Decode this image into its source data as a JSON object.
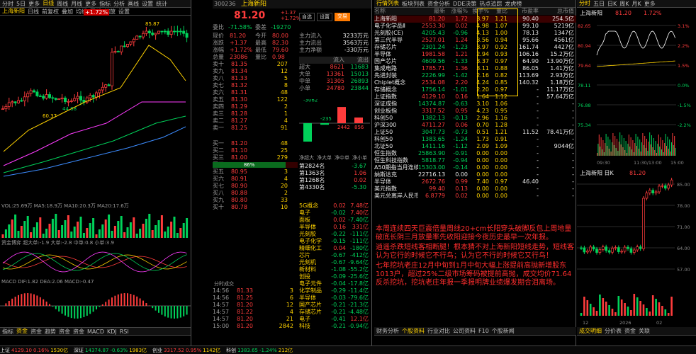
{
  "p1": {
    "topTabs": [
      "分时",
      "5日",
      "更多",
      "日线",
      "周线",
      "月线",
      "更多",
      "指标",
      "分析",
      "画线",
      "设置",
      "统计"
    ],
    "subTabs": [
      "上海新阳",
      "日线",
      "前复权",
      "叠加",
      "均线",
      "画线",
      "缩放",
      "设置"
    ],
    "badge": "+1.72%",
    "priceHi": "85.87",
    "labels": [
      "60.37",
      "44.88"
    ],
    "volTitle": "VOL:25.69万 MA5:18.9万 MA10:20.3万 MA20:17.6万",
    "macdTitle": "MACD DIF:1.82 DEA:2.06 MACD:-0.47",
    "fundTitle": "资金博弈 超大单:-1.9 大单:-2.8 中单:0.8 小单:3.9",
    "ddxTitle": "DDX:-0.12 DDY:0.08 DDZ:-3.42",
    "bottomTabs": [
      "指标",
      "资金",
      "资金",
      "趋势",
      "资金",
      "资金",
      "MACD",
      "KDJ",
      "RSI"
    ],
    "volLabel": "持续放量"
  },
  "p2": {
    "code": "300236",
    "name": "上海新阳",
    "price": "81.20",
    "chg": "+1.37",
    "pct": "+1.72%",
    "btn1": "自选",
    "btn2": "设置",
    "btn3": "交易",
    "hdr": [
      "委比",
      "-71.58%",
      "委差",
      "-19270"
    ],
    "stats": [
      [
        "现价",
        "81.20",
        "今开",
        "80.00"
      ],
      [
        "涨跌",
        "+1.37",
        "最高",
        "82.30"
      ],
      [
        "涨幅",
        "+1.72%",
        "最低",
        "79.60"
      ],
      [
        "总量",
        "23086",
        "量比",
        "0.98"
      ]
    ],
    "sells": [
      [
        "卖十",
        "81.35",
        "207"
      ],
      [
        "卖九",
        "81.34",
        "12"
      ],
      [
        "卖八",
        "81.33",
        "5"
      ],
      [
        "卖七",
        "81.32",
        "8"
      ],
      [
        "卖六",
        "81.31",
        "48"
      ],
      [
        "卖五",
        "81.30",
        "122"
      ],
      [
        "卖四",
        "81.29",
        "2"
      ],
      [
        "卖三",
        "81.28",
        "1"
      ],
      [
        "卖二",
        "81.27",
        "4"
      ],
      [
        "卖一",
        "81.25",
        "91"
      ]
    ],
    "buys": [
      [
        "买一",
        "81.20",
        "48"
      ],
      [
        "买二",
        "81.10",
        "25"
      ],
      [
        "买三",
        "81.00",
        "279"
      ],
      [
        "买四",
        "80.98",
        "1"
      ],
      [
        "买五",
        "80.95",
        "3"
      ],
      [
        "买六",
        "80.91",
        "4"
      ],
      [
        "买七",
        "80.90",
        "20"
      ],
      [
        "买八",
        "80.88",
        "2"
      ],
      [
        "买九",
        "80.80",
        "33"
      ],
      [
        "买十",
        "80.78",
        "10"
      ]
    ],
    "flowHead": [
      "流入",
      "流出"
    ],
    "flow": [
      [
        "超大",
        "8621",
        "11683"
      ],
      [
        "大单",
        "13361",
        "15013"
      ],
      [
        "中单",
        "31305",
        "26893"
      ],
      [
        "小单",
        "24780",
        "23844"
      ]
    ],
    "amt": [
      [
        "主力流入",
        "3233万元"
      ],
      [
        "主力流出",
        "3563万元"
      ],
      [
        "主力净额",
        "-330万元"
      ]
    ],
    "bars": [
      "-3062",
      "-235",
      "2442",
      "856"
    ],
    "barTabs": [
      "净超大",
      "净大单",
      "净中单",
      "净小单"
    ],
    "ranks": [
      [
        "第2824名",
        "-3.67"
      ],
      [
        "第1363名",
        "1.06"
      ],
      [
        "第1268名",
        "0.02"
      ],
      [
        "第4330名",
        "-5.30"
      ]
    ],
    "ratio": "86%",
    "ticks": [
      [
        "14:56",
        "81.33",
        "3"
      ],
      [
        "14:56",
        "81.25",
        "6"
      ],
      [
        "14:57",
        "81.20",
        "12"
      ],
      [
        "14:57",
        "81.22",
        "4"
      ],
      [
        "14:57",
        "81.20",
        "21"
      ],
      [
        "15:00",
        "81.20",
        "2842"
      ]
    ],
    "sectors": [
      [
        "5G概念",
        "0.02",
        "7.48亿"
      ],
      [
        "电子",
        "-0.02",
        "7.40亿"
      ],
      [
        "面板",
        "0.02",
        "-7.40亿"
      ],
      [
        "半导体",
        "0.16",
        "331亿"
      ],
      [
        "光刻胶",
        "-0.22",
        "-111亿"
      ],
      [
        "电子化学",
        "-0.15",
        "-111亿"
      ],
      [
        "精细化工",
        "0.04",
        "-180亿"
      ],
      [
        "芯片",
        "-0.67",
        "-412亿"
      ],
      [
        "光刻机",
        "-0.67",
        "-9.64亿"
      ],
      [
        "新材料",
        "-1.08",
        "-55.2亿"
      ],
      [
        "创投",
        "-0.09",
        "-25.6亿"
      ],
      [
        "电子元件",
        "-0.04",
        "-17.8亿"
      ],
      [
        "化学制品",
        "-0.29",
        "-11.4亿"
      ],
      [
        "半导体",
        "-0.03",
        "-79.6亿"
      ],
      [
        "国产芯片",
        "-0.21",
        "-21.3亿"
      ],
      [
        "存储芯片",
        "-0.21",
        "-4.48亿"
      ],
      [
        "电子",
        "-0.41",
        "12.1亿"
      ],
      [
        "科技",
        "-0.21",
        "-0.94亿"
      ]
    ],
    "status": "分时成交"
  },
  "p3": {
    "tabs": [
      "行情列表",
      "板块列表",
      "资金分析",
      "DDE决策",
      "热点追踪",
      "龙虎榜"
    ],
    "head": [
      "名称",
      "最新",
      "涨幅%",
      "换手%",
      "量比",
      "市盈率",
      "总市值"
    ],
    "rows": [
      [
        "上海新阳",
        "81.20",
        "1.72",
        "3.97",
        "1.21",
        "90.40",
        "254.5亿"
      ],
      [
        "电子化学品Ⅱ",
        "2553.30",
        "0.02",
        "4.98",
        "1.07",
        "99.10",
        "5219亿"
      ],
      [
        "光刻胶(CE)",
        "4205.43",
        "-0.96",
        "4.13",
        "1.00",
        "78.13",
        "1347亿"
      ],
      [
        "第三代半导",
        "2527.01",
        "1.24",
        "3.56",
        "0.94",
        "95.66",
        "4561亿"
      ],
      [
        "存储芯片",
        "2301.24",
        "-1.23",
        "3.97",
        "0.92",
        "161.74",
        "4427亿"
      ],
      [
        "半导体",
        "1981.58",
        "1.21",
        "2.94",
        "0.93",
        "106.16",
        "15.2万亿"
      ],
      [
        "国产芯片",
        "4609.56",
        "-1.33",
        "3.37",
        "0.97",
        "64.90",
        "13.90万亿"
      ],
      [
        "集成电路",
        "1785.71",
        "1.36",
        "3.11",
        "0.88",
        "86.05",
        "1.41万亿"
      ],
      [
        "先进封装",
        "2226.99",
        "-1.42",
        "2.16",
        "0.82",
        "113.69",
        "2.93万亿"
      ],
      [
        "Chiplet概念",
        "2534.08",
        "2.20",
        "4.24",
        "0.85",
        "140.32",
        "1.18万亿"
      ],
      [
        "存储概念",
        "1756.14",
        "-1.01",
        "2.20",
        "0.97",
        "-",
        "11.17万亿"
      ],
      [
        "上证指数",
        "4129.10",
        "0.16",
        "1.64",
        "1.12",
        "-",
        "57.64万亿"
      ],
      [
        "深证成指",
        "14374.87",
        "-0.63",
        "3.10",
        "1.06",
        "-",
        "-"
      ],
      [
        "创业板指",
        "3317.52",
        "0.95",
        "4.23",
        "0.95",
        "-",
        "-"
      ],
      [
        "科创50",
        "1382.13",
        "-0.13",
        "2.96",
        "1.16",
        "-",
        "-"
      ],
      [
        "沪深300",
        "4711.27",
        "0.06",
        "0.70",
        "1.28",
        "-",
        "-"
      ],
      [
        "上证50",
        "3047.73",
        "-0.73",
        "0.51",
        "1.21",
        "11.52",
        "78.41万亿"
      ],
      [
        "科创50",
        "1383.65",
        "-1.24",
        "1.73",
        "0.91",
        "-",
        "-"
      ],
      [
        "北证50",
        "1411.16",
        "-1.12",
        "2.09",
        "1.09",
        "-",
        "9044亿"
      ],
      [
        "恒生指数",
        "25863.90",
        "-0.91",
        "0.00",
        "0.00",
        "-",
        "-"
      ],
      [
        "恒生科技指数",
        "5818.77",
        "-0.94",
        "0.00",
        "0.00",
        "-",
        "-"
      ],
      [
        "A50期指当月连续",
        "15303.00",
        "-0.14",
        "0.00",
        "0.00",
        "-",
        "-"
      ],
      [
        "纳斯达克",
        "22716.13",
        "0.00",
        "0.00",
        "0.00",
        "-",
        "-"
      ],
      [
        "半导体",
        "2672.76",
        "0.99",
        "7.40",
        "0.97",
        "46.40",
        "-"
      ],
      [
        "美元指数",
        "99.40",
        "0.13",
        "0.00",
        "0.00",
        "-",
        "-"
      ],
      [
        "美元兑离岸人民币",
        "6.8779",
        "0.02",
        "0.00",
        "0.00",
        "-",
        "-"
      ]
    ],
    "notes": [
      "本周连续四天巨震倍量周线20+cm长阳穿头破脚反包上周地量破底长阴三月放量率先收阳迎接今夜历史最早一次年报。",
      "逍遥杀跌短线客相断腿！根本猜不对上海新阳短线走势，短线客认为它行的时候它不行鸟；认为它不行的时候它又行鸟！",
      "七年挖坑老庄12月中旬到1月中旬大幅上涨提前高抛新增股东1013户，超过25%二级市场筹码被提前高抛，成交均价71.64反杀挖坑，挖坑老庄年报一季报明牌业绩爆发期合泪离场。"
    ],
    "bottomTabs": [
      "财务分析",
      "个股资料",
      "行业对比",
      "公司资料",
      "F10",
      "个股新闻"
    ],
    "activeTab": "个股资料"
  },
  "p4": {
    "tabs": [
      "分时",
      "五日",
      "日K",
      "周K",
      "月K",
      "更多"
    ],
    "name": "上海新阳",
    "price": "81.20",
    "pct": "1.72%",
    "axis": [
      "82.65",
      "80.94",
      "79.64",
      "78.11",
      "76.88",
      "75.34"
    ],
    "pcts": [
      "3.1%",
      "2.2%",
      "1.5%",
      "0.0%",
      "-1.5%",
      "-2.2%"
    ],
    "times": [
      "09:30",
      "11:30/13:00",
      "15:00"
    ],
    "kName": "上海新阳 日K",
    "kPrice": "81.20",
    "kAxis": [
      "85.00",
      "78.00",
      "71.00",
      "64.00",
      "57.00"
    ],
    "kTimes": [
      "12",
      "2026",
      "02"
    ],
    "bottomTabs": [
      "成交明细",
      "分价表",
      "资金",
      "关联"
    ]
  },
  "statusBar": {
    "items": [
      [
        "上证",
        "4129.10",
        "0.16%",
        "1530亿"
      ],
      [
        "深证",
        "14374.87",
        "-0.63%",
        "1983亿"
      ],
      [
        "创业",
        "3317.52",
        "0.95%",
        "1142亿"
      ],
      [
        "科创",
        "1383.65",
        "-1.24%",
        "212亿"
      ]
    ],
    "segs": [
      "4.33",
      "0.10%",
      "4.33",
      "0.08%"
    ]
  }
}
